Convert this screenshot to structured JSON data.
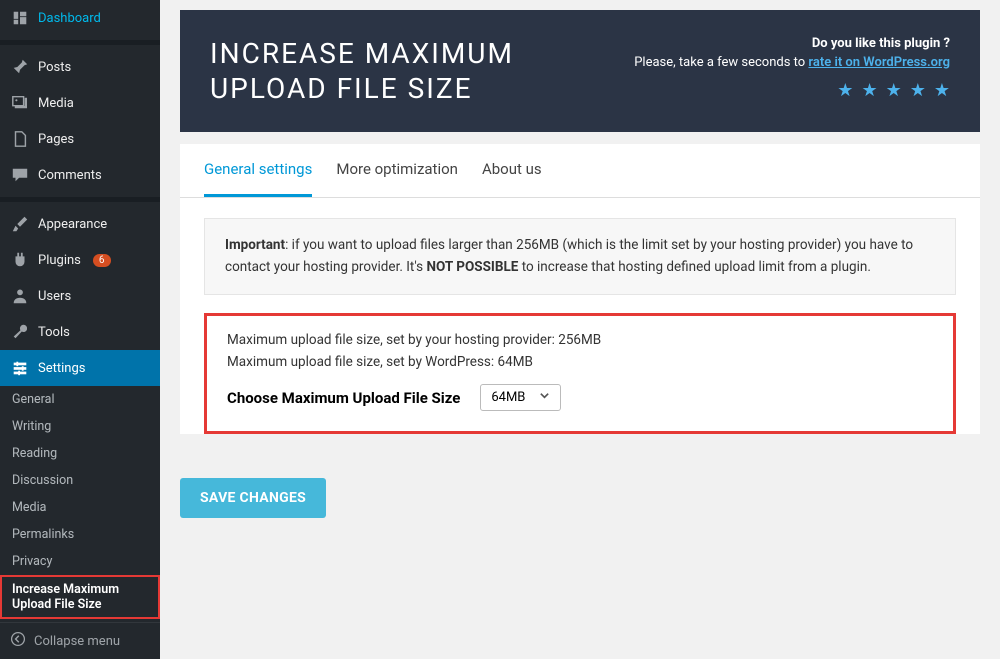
{
  "sidebar": {
    "main": [
      {
        "icon": "dashboard",
        "label": "Dashboard"
      },
      {
        "icon": "pin",
        "label": "Posts"
      },
      {
        "icon": "media",
        "label": "Media"
      },
      {
        "icon": "page",
        "label": "Pages"
      },
      {
        "icon": "comment",
        "label": "Comments"
      }
    ],
    "secondary": [
      {
        "icon": "brush",
        "label": "Appearance"
      },
      {
        "icon": "plugin",
        "label": "Plugins",
        "badge": "6"
      },
      {
        "icon": "user",
        "label": "Users"
      },
      {
        "icon": "tools",
        "label": "Tools"
      },
      {
        "icon": "settings",
        "label": "Settings",
        "active": true
      }
    ],
    "subs": [
      {
        "label": "General"
      },
      {
        "label": "Writing"
      },
      {
        "label": "Reading"
      },
      {
        "label": "Discussion"
      },
      {
        "label": "Media"
      },
      {
        "label": "Permalinks"
      },
      {
        "label": "Privacy"
      },
      {
        "label": "Increase Maximum Upload File Size",
        "highlighted": true
      }
    ],
    "collapse": "Collapse menu"
  },
  "header": {
    "title_line1": "INCREASE MAXIMUM",
    "title_line2": "UPLOAD FILE SIZE",
    "like": "Do you like this plugin ?",
    "rate_prefix": "Please, take a few seconds to ",
    "rate_link": "rate it on WordPress.org"
  },
  "tabs": [
    {
      "label": "General settings",
      "active": true
    },
    {
      "label": "More optimization"
    },
    {
      "label": "About us"
    }
  ],
  "notice": {
    "important": "Important",
    "text1": ": if you want to upload files larger than 256MB (which is the limit set by your hosting provider) you have to contact your hosting provider. It's ",
    "not_possible": "NOT POSSIBLE",
    "text2": " to increase that hosting defined upload limit from a plugin."
  },
  "settings": {
    "host_line": "Maximum upload file size, set by your hosting provider: 256MB",
    "wp_line": "Maximum upload file size, set by WordPress: 64MB",
    "choose_label": "Choose Maximum Upload File Size",
    "selected": "64MB"
  },
  "save_btn": "SAVE CHANGES"
}
